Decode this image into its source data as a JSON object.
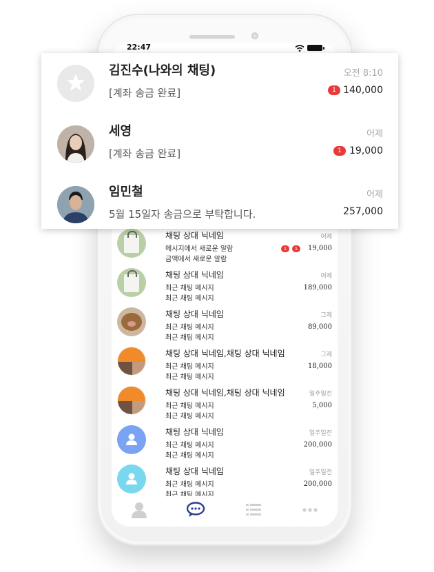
{
  "status": {
    "time": "22:47"
  },
  "card": {
    "rows": [
      {
        "name": "김진수(나와의 채팅)",
        "message": "[계좌 송금 완료]",
        "time": "오전 8:10",
        "badge": "1",
        "amount": "140,000",
        "avatar": "star-icon"
      },
      {
        "name": "세영",
        "message": "[계좌 송금 완료]",
        "time": "어제",
        "badge": "1",
        "amount": "19,000",
        "avatar": "woman-photo"
      },
      {
        "name": "임민철",
        "message": "5월 15일자 송금으로 부탁합니다.",
        "time": "어제",
        "badge": "",
        "amount": "257,000",
        "avatar": "man-photo"
      }
    ]
  },
  "list": [
    {
      "name": "채팅 상대 닉네임",
      "msg1": "메시지에서 새로운 알람",
      "msg2": "금액에서 새로운 알람",
      "time": "어제",
      "amount": "19,000",
      "badges": [
        "1",
        "1"
      ],
      "avatar": "shopping-bag"
    },
    {
      "name": "채팅 상대 닉네임",
      "msg1": "최근 채팅 메시지",
      "msg2": "최근 채팅 메시지",
      "time": "어제",
      "amount": "189,000",
      "badges": [],
      "avatar": "shopping-bag"
    },
    {
      "name": "채팅 상대 닉네임",
      "msg1": "최근 채팅 메시지",
      "msg2": "최근 채팅 메시지",
      "time": "그제",
      "amount": "89,000",
      "badges": [],
      "avatar": "plush-pig"
    },
    {
      "name": "채팅 상대 닉네임,채팅 상대 닉네임",
      "msg1": "최근 채팅 메시지",
      "msg2": "최근 채팅 메시지",
      "time": "그제",
      "amount": "18,000",
      "badges": [],
      "avatar": "group-photo"
    },
    {
      "name": "채팅 상대 닉네임,채팅 상대 닉네임",
      "msg1": "최근 채팅 메시지",
      "msg2": "최근 채팅 메시지",
      "time": "일주일전",
      "amount": "5,000",
      "badges": [],
      "avatar": "group-photo"
    },
    {
      "name": "채팅 상대 닉네임",
      "msg1": "최근 채팅 메시지",
      "msg2": "최근 채팅 메시지",
      "time": "일주일전",
      "amount": "200,000",
      "badges": [],
      "avatar": "person-icon"
    },
    {
      "name": "채팅 상대 닉네임",
      "msg1": "최근 채팅 메시지",
      "msg2": "최근 채팅 메시지",
      "time": "일주일전",
      "amount": "200,000",
      "badges": [],
      "avatar": "person-icon"
    }
  ],
  "tabs": [
    {
      "icon": "person-icon",
      "active": false
    },
    {
      "icon": "chat-bubble-icon",
      "active": true
    },
    {
      "icon": "list-icon",
      "active": false
    },
    {
      "icon": "more-dots-icon",
      "active": false
    }
  ],
  "colors": {
    "badge": "#e93a3a",
    "active_tab": "#2f3f8f",
    "inactive_tab": "#cfcfcf",
    "muted_text": "#aaaaaa"
  }
}
